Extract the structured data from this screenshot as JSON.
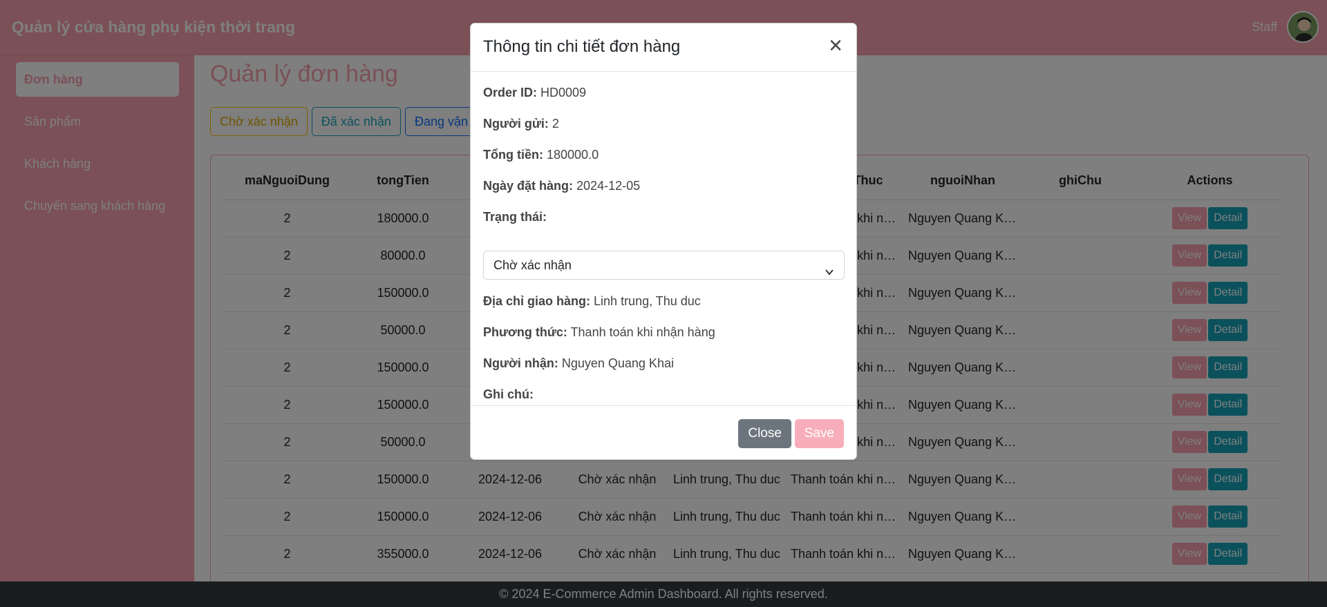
{
  "header": {
    "brand": "Quản lý cửa hàng phụ kiện thời trang",
    "staff_label": "Staff"
  },
  "sidebar": {
    "items": [
      {
        "label": "Đơn hàng",
        "active": true
      },
      {
        "label": "Sản phẩm",
        "active": false
      },
      {
        "label": "Khách hàng",
        "active": false
      },
      {
        "label": "Chuyển sang khách hàng",
        "active": false
      }
    ]
  },
  "main": {
    "title": "Quản lý đơn hàng",
    "filters": [
      "Chờ xác nhận",
      "Đã xác nhận",
      "Đang vận"
    ],
    "table": {
      "columns": [
        "maNguoiDung",
        "tongTien",
        "",
        "",
        "",
        "phuongThuc",
        "nguoiNhan",
        "ghiChu",
        "Actions"
      ],
      "rows": [
        [
          "2",
          "180000.0",
          "",
          "",
          "",
          "Thanh toán khi nhận hàng",
          "Nguyen Quang Khai",
          ""
        ],
        [
          "2",
          "80000.0",
          "",
          "",
          "",
          "Thanh toán khi nhận hàng",
          "Nguyen Quang Khai",
          ""
        ],
        [
          "2",
          "150000.0",
          "",
          "",
          "",
          "Thanh toán khi nhận hàng",
          "Nguyen Quang Khai",
          ""
        ],
        [
          "2",
          "50000.0",
          "",
          "",
          "",
          "Thanh toán khi nhận hàng",
          "Nguyen Quang Khai",
          ""
        ],
        [
          "2",
          "150000.0",
          "",
          "",
          "",
          "Thanh toán khi nhận hàng",
          "Nguyen Quang Khai",
          ""
        ],
        [
          "2",
          "150000.0",
          "",
          "",
          "",
          "Thanh toán khi nhận hàng",
          "Nguyen Quang Khai",
          ""
        ],
        [
          "2",
          "50000.0",
          "",
          "",
          "",
          "Thanh toán khi nhận hàng",
          "Nguyen Quang Khai",
          ""
        ],
        [
          "2",
          "150000.0",
          "2024-12-06",
          "Chờ xác nhận",
          "Linh trung, Thu duc",
          "Thanh toán khi nhận hàng",
          "Nguyen Quang Khai",
          ""
        ],
        [
          "2",
          "150000.0",
          "2024-12-06",
          "Chờ xác nhận",
          "Linh trung, Thu duc",
          "Thanh toán khi nhận hàng",
          "Nguyen Quang Khai",
          ""
        ],
        [
          "2",
          "355000.0",
          "2024-12-06",
          "Chờ xác nhận",
          "Linh trung, Thu duc",
          "Thanh toán khi nhận hàng",
          "Nguyen Quang Khai",
          ""
        ]
      ],
      "view_label": "View",
      "detail_label": "Detail"
    }
  },
  "footer": {
    "text": "© 2024 E-Commerce Admin Dashboard. All rights reserved."
  },
  "modal": {
    "title": "Thông tin chi tiết đơn hàng",
    "order_id_label": "Order ID:",
    "order_id": "HD0009",
    "sender_label": "Người gửi:",
    "sender": "2",
    "total_label": "Tổng tiền:",
    "total": "180000.0",
    "date_label": "Ngày đặt hàng:",
    "date": "2024-12-05",
    "status_label": "Trạng thái:",
    "status_selected": "Chờ xác nhận",
    "address_label": "Địa chỉ giao hàng:",
    "address": "Linh trung, Thu duc",
    "method_label": "Phương thức:",
    "method": "Thanh toán khi nhận hàng",
    "receiver_label": "Người nhận:",
    "receiver": "Nguyen Quang Khai",
    "note_label": "Ghi chú:",
    "note": "",
    "close_label": "Close",
    "save_label": "Save"
  }
}
